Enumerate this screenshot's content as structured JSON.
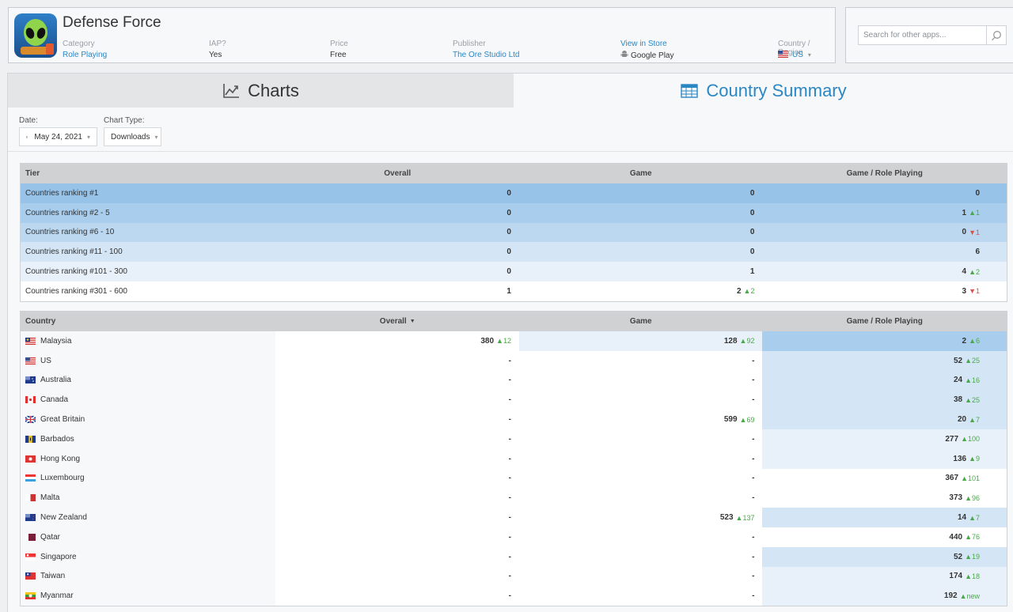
{
  "app": {
    "title": "Defense Force",
    "category_label": "Category",
    "category_value": "Role Playing",
    "iap_label": "IAP?",
    "iap_value": "Yes",
    "price_label": "Price",
    "price_value": "Free",
    "publisher_label": "Publisher",
    "publisher_value": "The Ore Studio Ltd",
    "store_link": "View in Store",
    "store_value": "Google Play",
    "country_label": "Country / Region",
    "country_value": "US"
  },
  "search": {
    "placeholder": "Search for other apps..."
  },
  "tabs": {
    "charts": "Charts",
    "country_summary": "Country Summary"
  },
  "filters": {
    "date_label": "Date:",
    "date_value": "May 24, 2021",
    "chart_type_label": "Chart Type:",
    "chart_type_value": "Downloads"
  },
  "tier_table": {
    "headers": [
      "Tier",
      "Overall",
      "Game",
      "Game / Role Playing"
    ],
    "rows": [
      {
        "name": "Countries ranking #1",
        "overall": "0",
        "game": "0",
        "game_ch": "",
        "role": "0",
        "role_ch": "",
        "role_dir": "",
        "bg": "#98c3e8"
      },
      {
        "name": "Countries ranking #2 - 5",
        "overall": "0",
        "game": "0",
        "game_ch": "",
        "role": "1",
        "role_ch": "▲1",
        "role_dir": "up",
        "bg": "#a9cdec"
      },
      {
        "name": "Countries ranking #6 - 10",
        "overall": "0",
        "game": "0",
        "game_ch": "",
        "role": "0",
        "role_ch": "▼1",
        "role_dir": "down",
        "bg": "#bcd8f0"
      },
      {
        "name": "Countries ranking #11 - 100",
        "overall": "0",
        "game": "0",
        "game_ch": "",
        "role": "6",
        "role_ch": "",
        "role_dir": "",
        "bg": "#d4e6f6"
      },
      {
        "name": "Countries ranking #101 - 300",
        "overall": "0",
        "game": "1",
        "game_ch": "",
        "role": "4",
        "role_ch": "▲2",
        "role_dir": "up",
        "bg": "#e8f1fa"
      },
      {
        "name": "Countries ranking #301 - 600",
        "overall": "1",
        "game": "2",
        "game_ch": "▲2",
        "role": "3",
        "role_ch": "▼1",
        "role_dir": "down",
        "bg": "#ffffff"
      }
    ]
  },
  "country_table": {
    "headers": [
      "Country",
      "Overall",
      "Game",
      "Game / Role Playing"
    ],
    "rows": [
      {
        "country": "Malaysia",
        "overall": "380",
        "overall_ch": "▲12",
        "game": "128",
        "game_ch": "▲92",
        "role": "2",
        "role_ch": "▲6",
        "ov_bg": "#ffffff",
        "g_bg": "#e8f1fa",
        "r_bg": "#a9cdec"
      },
      {
        "country": "US",
        "overall": "-",
        "overall_ch": "",
        "game": "-",
        "game_ch": "",
        "role": "52",
        "role_ch": "▲25",
        "ov_bg": "#ffffff",
        "g_bg": "#ffffff",
        "r_bg": "#d4e6f6"
      },
      {
        "country": "Australia",
        "overall": "-",
        "overall_ch": "",
        "game": "-",
        "game_ch": "",
        "role": "24",
        "role_ch": "▲16",
        "ov_bg": "#ffffff",
        "g_bg": "#ffffff",
        "r_bg": "#d4e6f6"
      },
      {
        "country": "Canada",
        "overall": "-",
        "overall_ch": "",
        "game": "-",
        "game_ch": "",
        "role": "38",
        "role_ch": "▲25",
        "ov_bg": "#ffffff",
        "g_bg": "#ffffff",
        "r_bg": "#d4e6f6"
      },
      {
        "country": "Great Britain",
        "overall": "-",
        "overall_ch": "",
        "game": "599",
        "game_ch": "▲69",
        "role": "20",
        "role_ch": "▲7",
        "ov_bg": "#ffffff",
        "g_bg": "#ffffff",
        "r_bg": "#d4e6f6"
      },
      {
        "country": "Barbados",
        "overall": "-",
        "overall_ch": "",
        "game": "-",
        "game_ch": "",
        "role": "277",
        "role_ch": "▲100",
        "ov_bg": "#ffffff",
        "g_bg": "#ffffff",
        "r_bg": "#e8f1fa"
      },
      {
        "country": "Hong Kong",
        "overall": "-",
        "overall_ch": "",
        "game": "-",
        "game_ch": "",
        "role": "136",
        "role_ch": "▲9",
        "ov_bg": "#ffffff",
        "g_bg": "#ffffff",
        "r_bg": "#e8f1fa"
      },
      {
        "country": "Luxembourg",
        "overall": "-",
        "overall_ch": "",
        "game": "-",
        "game_ch": "",
        "role": "367",
        "role_ch": "▲101",
        "ov_bg": "#ffffff",
        "g_bg": "#ffffff",
        "r_bg": "#ffffff"
      },
      {
        "country": "Malta",
        "overall": "-",
        "overall_ch": "",
        "game": "-",
        "game_ch": "",
        "role": "373",
        "role_ch": "▲96",
        "ov_bg": "#ffffff",
        "g_bg": "#ffffff",
        "r_bg": "#ffffff"
      },
      {
        "country": "New Zealand",
        "overall": "-",
        "overall_ch": "",
        "game": "523",
        "game_ch": "▲137",
        "role": "14",
        "role_ch": "▲7",
        "ov_bg": "#ffffff",
        "g_bg": "#ffffff",
        "r_bg": "#d4e6f6"
      },
      {
        "country": "Qatar",
        "overall": "-",
        "overall_ch": "",
        "game": "-",
        "game_ch": "",
        "role": "440",
        "role_ch": "▲76",
        "ov_bg": "#ffffff",
        "g_bg": "#ffffff",
        "r_bg": "#ffffff"
      },
      {
        "country": "Singapore",
        "overall": "-",
        "overall_ch": "",
        "game": "-",
        "game_ch": "",
        "role": "52",
        "role_ch": "▲19",
        "ov_bg": "#ffffff",
        "g_bg": "#ffffff",
        "r_bg": "#d4e6f6"
      },
      {
        "country": "Taiwan",
        "overall": "-",
        "overall_ch": "",
        "game": "-",
        "game_ch": "",
        "role": "174",
        "role_ch": "▲18",
        "ov_bg": "#ffffff",
        "g_bg": "#ffffff",
        "r_bg": "#e8f1fa"
      },
      {
        "country": "Myanmar",
        "overall": "-",
        "overall_ch": "",
        "game": "-",
        "game_ch": "",
        "role": "192",
        "role_ch": "▲new",
        "ov_bg": "#ffffff",
        "g_bg": "#ffffff",
        "r_bg": "#e8f1fa"
      }
    ]
  },
  "colors": {
    "accent": "#2a87c5",
    "up": "#4aa84a",
    "down": "#d9534f",
    "header_bg": "#cfd1d3"
  },
  "icons": {
    "search": "search-icon",
    "charts": "line-chart-icon",
    "summary": "table-icon",
    "calendar": "calendar-icon",
    "android": "android-icon"
  }
}
